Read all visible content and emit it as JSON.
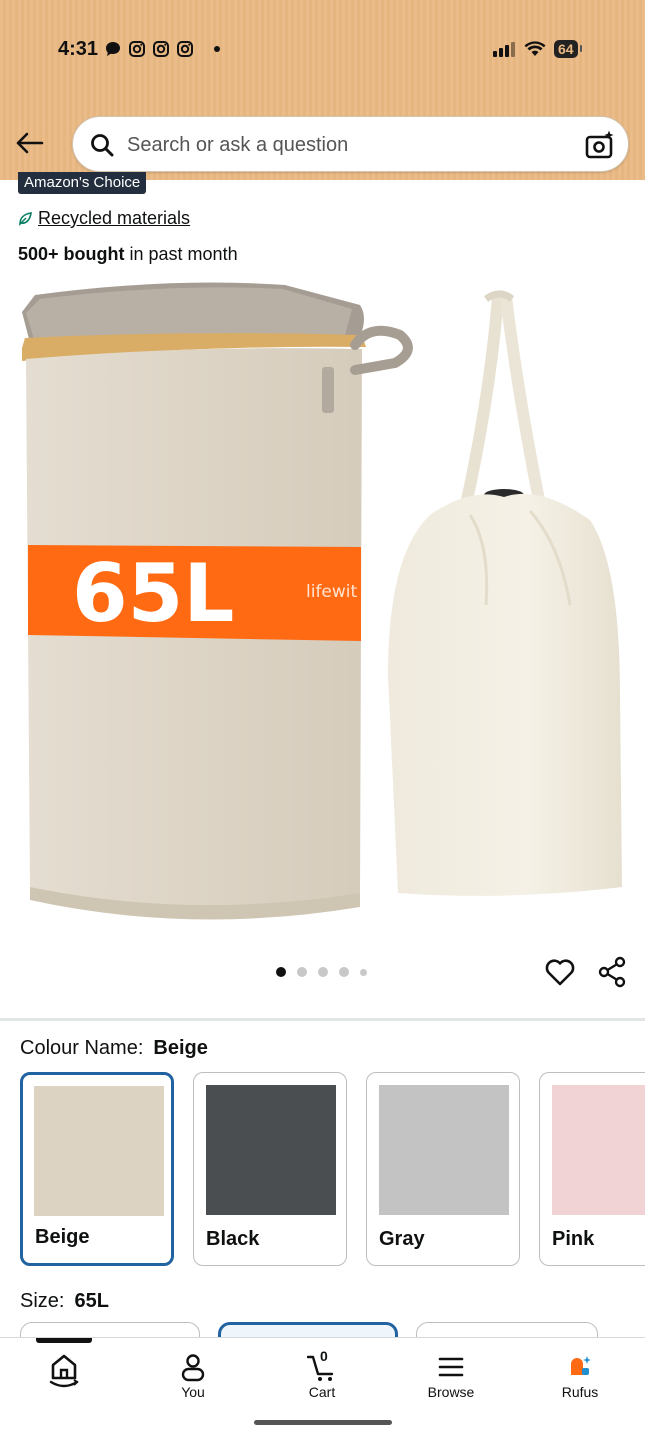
{
  "status_bar": {
    "time": "4:31",
    "battery": "64"
  },
  "search": {
    "placeholder": "Search or ask a question"
  },
  "product": {
    "badge": "Amazon's Choice",
    "recycled_label": "Recycled materials",
    "bought_bold": "500+ bought",
    "bought_rest": " in past month",
    "image_text": {
      "capacity": "65L",
      "brand": "lifewit"
    },
    "image_dots": {
      "count": 5,
      "active_index": 0
    }
  },
  "colour": {
    "label": "Colour Name:",
    "selected": "Beige",
    "options": [
      {
        "name": "Beige",
        "color": "#ddd3c3"
      },
      {
        "name": "Black",
        "color": "#4b4e51"
      },
      {
        "name": "Gray",
        "color": "#c3c3c4"
      },
      {
        "name": "Pink",
        "color": "#f1d3d6"
      }
    ]
  },
  "size": {
    "label": "Size:",
    "selected": "65L"
  },
  "bottom_nav": {
    "items": [
      {
        "label": "",
        "icon": "home-icon"
      },
      {
        "label": "You",
        "icon": "user-icon"
      },
      {
        "label": "Cart",
        "icon": "cart-icon",
        "badge": "0"
      },
      {
        "label": "Browse",
        "icon": "menu-icon"
      },
      {
        "label": "Rufus",
        "icon": "rufus-icon"
      }
    ]
  },
  "colors": {
    "header_bg": "#eab983",
    "selected_border": "#2162a1",
    "image_band": "#ff6a13"
  }
}
